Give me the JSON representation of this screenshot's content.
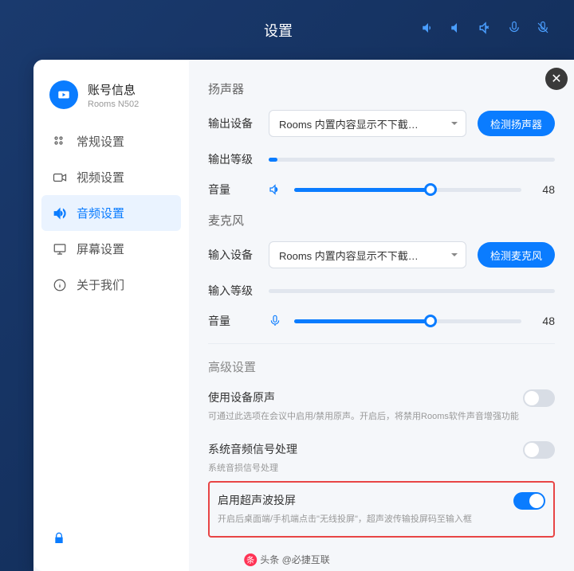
{
  "topbar": {
    "title": "设置"
  },
  "account": {
    "name": "账号信息",
    "sub": "Rooms N502"
  },
  "nav": {
    "general": "常规设置",
    "video": "视频设置",
    "audio": "音频设置",
    "screen": "屏幕设置",
    "about": "关于我们"
  },
  "speaker": {
    "title": "扬声器",
    "output_device_label": "输出设备",
    "output_device_value": "Rooms 内置内容显示不下截…",
    "test_btn": "检测扬声器",
    "output_level_label": "输出等级",
    "output_level_pct": 3,
    "volume_label": "音量",
    "volume_value": 48
  },
  "mic": {
    "title": "麦克风",
    "input_device_label": "输入设备",
    "input_device_value": "Rooms 内置内容显示不下截…",
    "test_btn": "检测麦克风",
    "input_level_label": "输入等级",
    "input_level_pct": 0,
    "volume_label": "音量",
    "volume_value": 48
  },
  "advanced": {
    "title": "高级设置",
    "original_sound": {
      "label": "使用设备原声",
      "desc": "可通过此选项在会议中启用/禁用原声。开启后，将禁用Rooms软件声音增强功能",
      "on": false
    },
    "signal_proc": {
      "label": "系统音频信号处理",
      "desc": "系统音损信号处理",
      "on": false
    },
    "ultrasonic": {
      "label": "启用超声波投屏",
      "desc": "开启后桌面端/手机端点击\"无线投屏\"，超声波传输投屏码至输入框",
      "on": true
    }
  },
  "watermark": "头条 @必捷互联"
}
